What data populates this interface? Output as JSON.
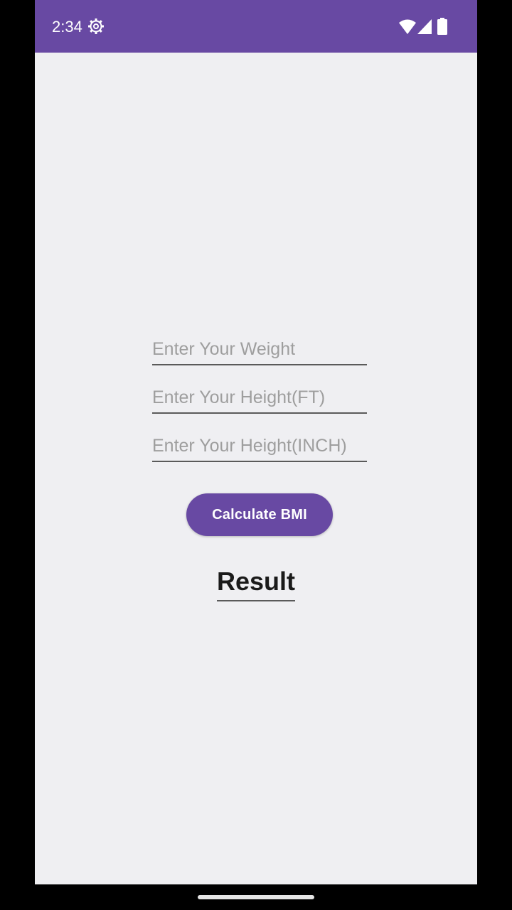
{
  "status_bar": {
    "time": "2:34",
    "background_color": "#6849a3",
    "icons": [
      "gear-icon",
      "wifi-icon",
      "cellular-signal-icon",
      "battery-icon"
    ]
  },
  "form": {
    "weight_placeholder": "Enter Your Weight",
    "height_ft_placeholder": "Enter Your Height(FT)",
    "height_inch_placeholder": "Enter Your Height(INCH)",
    "calculate_label": "Calculate BMI",
    "result_label": "Result"
  },
  "colors": {
    "accent": "#6849a3",
    "screen_background": "#efeff2"
  }
}
